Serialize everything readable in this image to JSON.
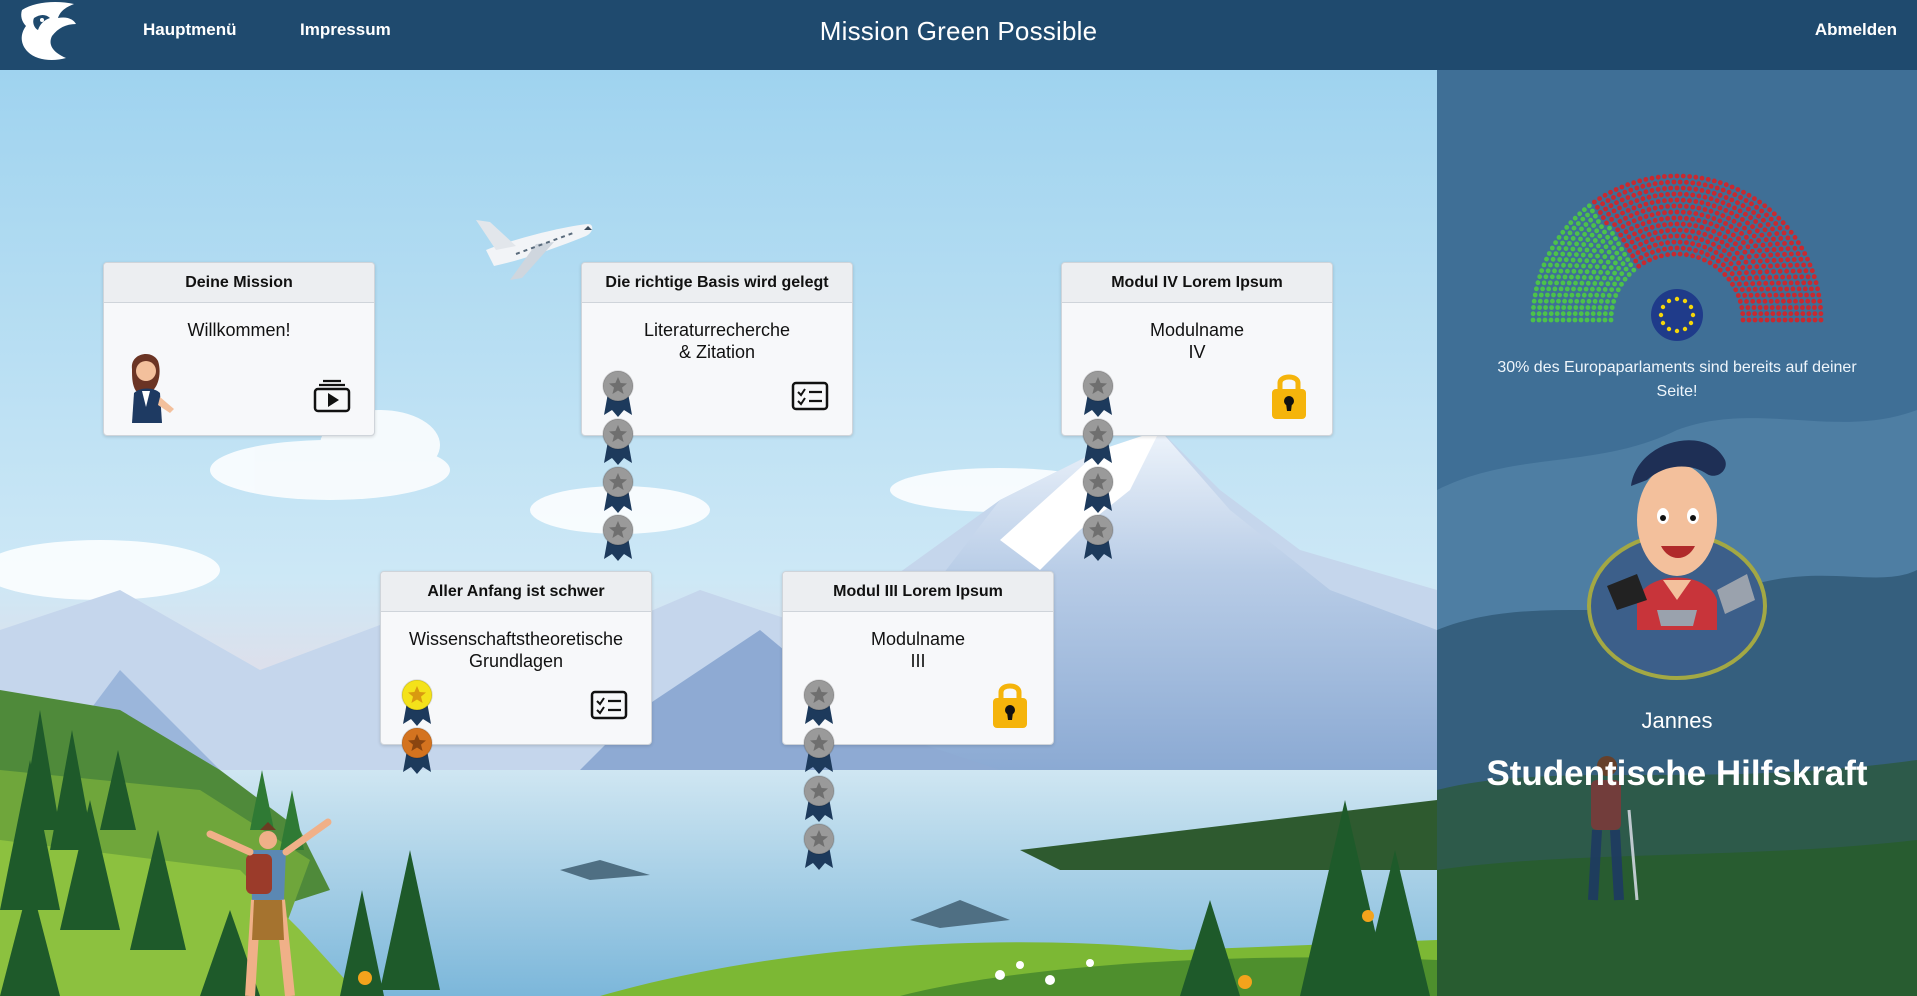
{
  "topbar": {
    "title": "Mission Green Possible",
    "nav": {
      "main_menu": "Hauptmenü",
      "imprint": "Impressum"
    },
    "logout": "Abmelden",
    "logo_icon": "dragon-logo-icon"
  },
  "modules": [
    {
      "header": "Deine Mission",
      "title_line1": "Willkommen!",
      "title_line2": "",
      "icon": "video-play-icon",
      "locked": false,
      "medals": []
    },
    {
      "header": "Die richtige Basis wird gelegt",
      "title_line1": "Literaturrecherche",
      "title_line2": "& Zitation",
      "icon": "quiz-checklist-icon",
      "locked": false,
      "medals": [
        "grey",
        "grey",
        "grey",
        "grey"
      ]
    },
    {
      "header": "Modul IV Lorem Ipsum",
      "title_line1": "Modulname",
      "title_line2": "IV",
      "icon": "lock-icon",
      "locked": true,
      "medals": [
        "grey",
        "grey",
        "grey",
        "grey"
      ]
    },
    {
      "header": "Aller Anfang ist schwer",
      "title_line1": "Wissenschaftstheoretische",
      "title_line2": "Grundlagen",
      "icon": "quiz-checklist-icon",
      "locked": false,
      "medals": [
        "gold",
        "bronze"
      ]
    },
    {
      "header": "Modul III Lorem Ipsum",
      "title_line1": "Modulname",
      "title_line2": "III",
      "icon": "lock-icon",
      "locked": true,
      "medals": [
        "grey",
        "grey",
        "grey",
        "grey"
      ]
    }
  ],
  "side_panel": {
    "parliament_caption": "30% des Europaparlaments sind bereits auf deiner Seite!",
    "parliament_support_fraction": 0.3,
    "player_name": "Jannes",
    "player_role": "Studentische Hilfskraft"
  },
  "colors": {
    "topbar": "#1f4a6e",
    "support_green": "#4cc24a",
    "opposition_red": "#c9292f",
    "medal_gold": "#f4e21a",
    "medal_bronze": "#d4731f",
    "medal_grey": "#9a9a9a",
    "ribbon_navy": "#1d3a5c",
    "lock_yellow": "#f5b40b"
  }
}
